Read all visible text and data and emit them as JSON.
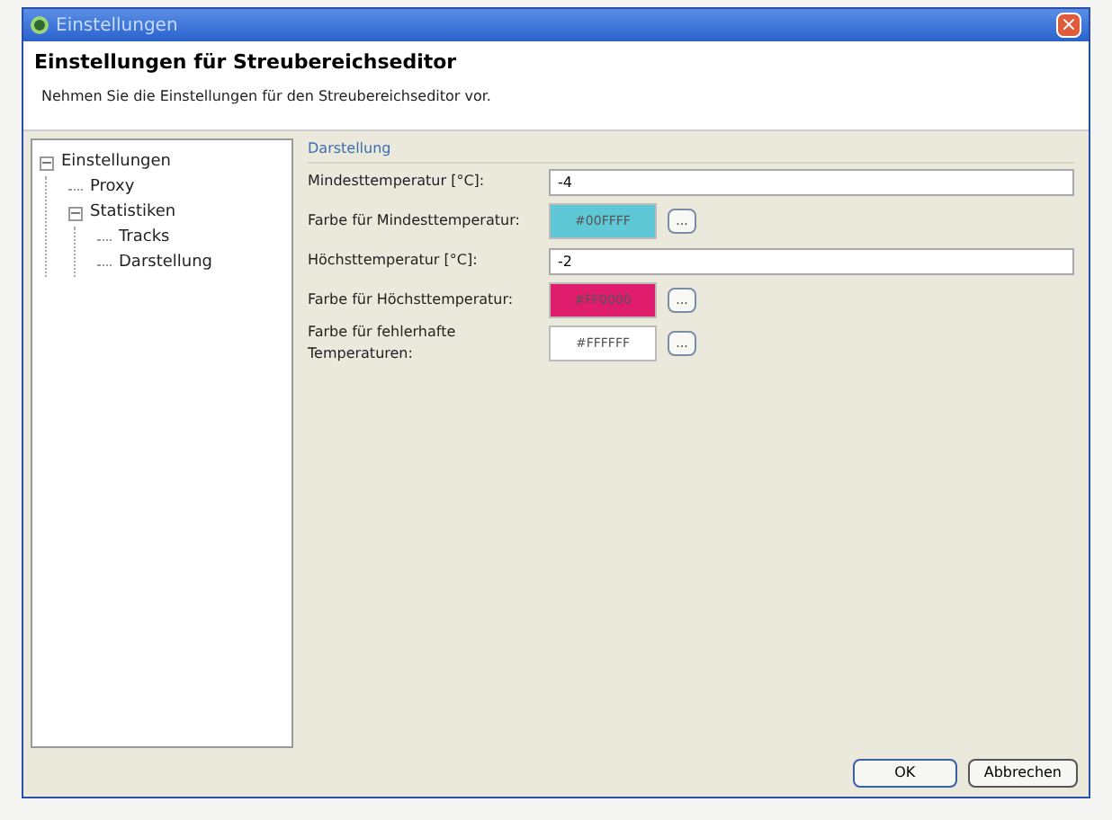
{
  "window": {
    "title": "Einstellungen",
    "close": "×"
  },
  "header": {
    "title": "Einstellungen für Streubereichseditor",
    "subtitle": "Nehmen Sie die Einstellungen für den Streubereichseditor vor."
  },
  "tree": [
    {
      "label": "Einstellungen",
      "expander": "−",
      "children": [
        {
          "label": "Proxy"
        },
        {
          "label": "Statistiken",
          "expander": "−",
          "children": [
            {
              "label": "Tracks"
            },
            {
              "label": "Darstellung"
            }
          ]
        }
      ]
    }
  ],
  "section": {
    "title": "Darstellung"
  },
  "fields": [
    {
      "kind": "text",
      "label": "Mindesttemperatur [°C]:",
      "value": "-4"
    },
    {
      "kind": "color",
      "label": "Farbe für Mindesttemperatur:",
      "value": "#00FFFF",
      "color": "#5fc8d6",
      "picker": "..."
    },
    {
      "kind": "text",
      "label": "Höchsttemperatur [°C]:",
      "value": "-2"
    },
    {
      "kind": "color",
      "label": "Farbe für Höchsttemperatur:",
      "value": "#FF0000",
      "color": "#e01c6c",
      "picker": "..."
    },
    {
      "kind": "color",
      "label": "Farbe für fehlerhafte Temperaturen:",
      "value": "#FFFFFF",
      "color": "#ffffff",
      "picker": "..."
    }
  ],
  "buttons": [
    "OK",
    "Abbrechen"
  ]
}
